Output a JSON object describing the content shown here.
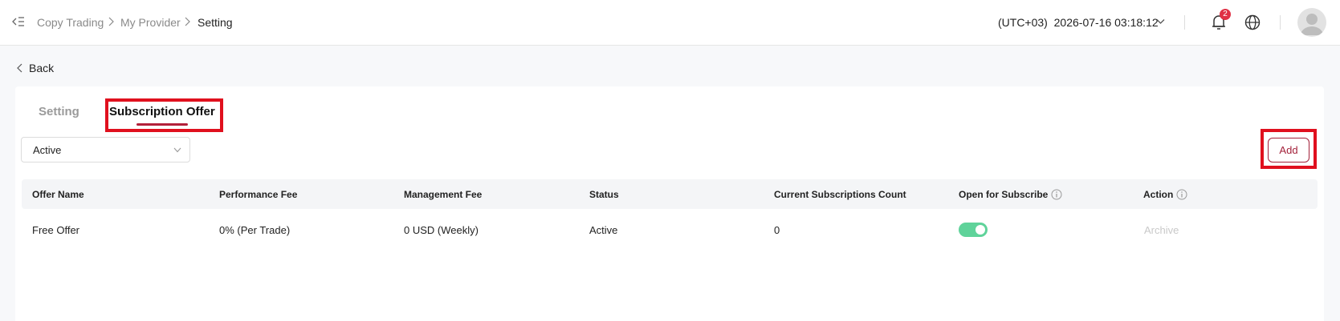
{
  "breadcrumb": {
    "items": [
      "Copy Trading",
      "My Provider",
      "Setting"
    ]
  },
  "header": {
    "timezone": "(UTC+03)",
    "datetime": "2026-07-16 03:18:12",
    "notification_count": "2"
  },
  "back": {
    "label": "Back"
  },
  "tabs": [
    {
      "label": "Setting",
      "active": false
    },
    {
      "label": "Subscription Offer",
      "active": true
    }
  ],
  "filter": {
    "selected": "Active"
  },
  "add_button": {
    "label": "Add"
  },
  "table": {
    "columns": [
      "Offer Name",
      "Performance Fee",
      "Management Fee",
      "Status",
      "Current Subscriptions Count",
      "Open for Subscribe",
      "Action"
    ],
    "rows": [
      {
        "offer_name": "Free Offer",
        "performance_fee": "0% (Per Trade)",
        "management_fee": "0 USD (Weekly)",
        "status": "Active",
        "subscriptions_count": "0",
        "open_for_subscribe": true,
        "action": "Archive"
      }
    ]
  },
  "colors": {
    "accent": "#a3213a",
    "toggle_on": "#5fd39a",
    "highlight": "#e0101e",
    "badge": "#e03045"
  },
  "icons": [
    "menu-collapse-icon",
    "chevron-right-icon",
    "chevron-down-icon",
    "bell-icon",
    "globe-icon",
    "avatar-icon",
    "chevron-left-icon",
    "info-icon"
  ]
}
